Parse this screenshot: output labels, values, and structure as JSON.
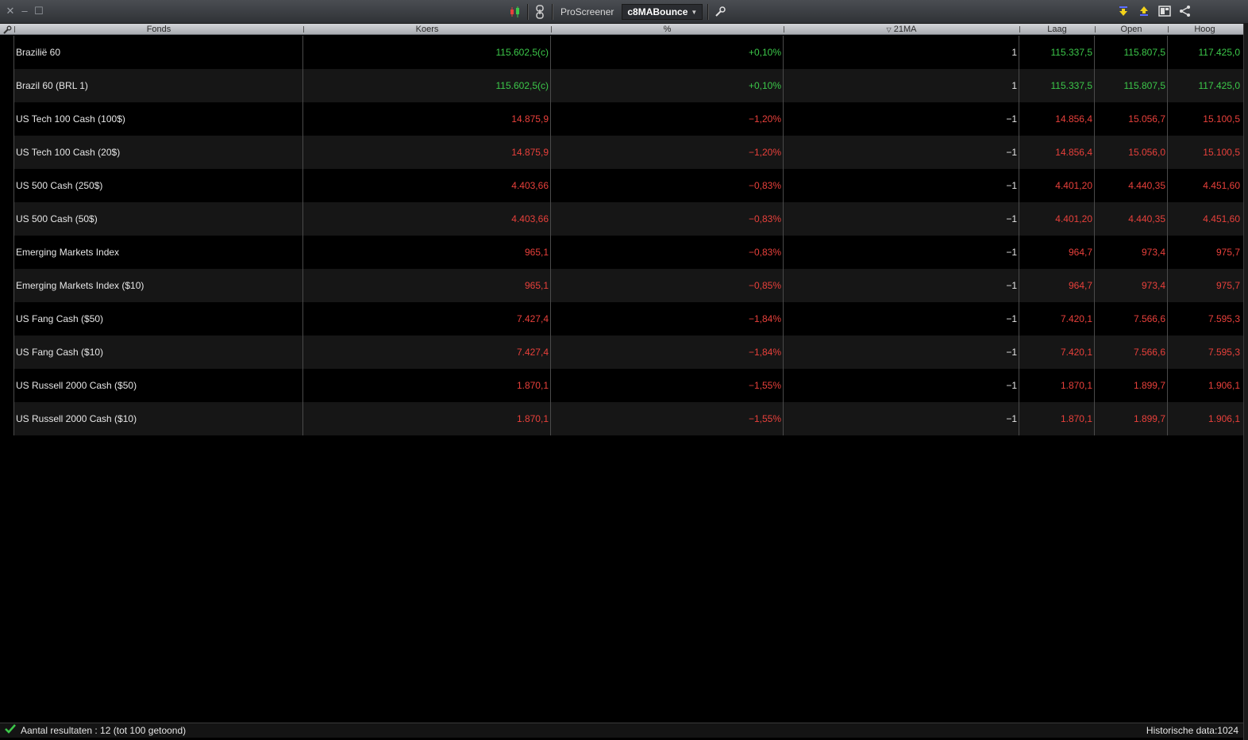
{
  "toolbar": {
    "screener_label": "ProScreener",
    "screener_name": "c8MABounce"
  },
  "columns": {
    "fonds": "Fonds",
    "koers": "Koers",
    "pct": "%",
    "ma": "21MA",
    "laag": "Laag",
    "open": "Open",
    "hoog": "Hoog"
  },
  "rows": [
    {
      "name": "Brazilië 60",
      "koers": "115.602,5(c)",
      "pct": "+0,10%",
      "ma": "1",
      "laag": "115.337,5",
      "open": "115.807,5",
      "hoog": "117.425,0",
      "dir": "up"
    },
    {
      "name": "Brazil 60 (BRL 1)",
      "koers": "115.602,5(c)",
      "pct": "+0,10%",
      "ma": "1",
      "laag": "115.337,5",
      "open": "115.807,5",
      "hoog": "117.425,0",
      "dir": "up"
    },
    {
      "name": "US Tech 100 Cash (100$)",
      "koers": "14.875,9",
      "pct": "−1,20%",
      "ma": "−1",
      "laag": "14.856,4",
      "open": "15.056,7",
      "hoog": "15.100,5",
      "dir": "down"
    },
    {
      "name": "US Tech 100 Cash (20$)",
      "koers": "14.875,9",
      "pct": "−1,20%",
      "ma": "−1",
      "laag": "14.856,4",
      "open": "15.056,0",
      "hoog": "15.100,5",
      "dir": "down"
    },
    {
      "name": "US 500 Cash (250$)",
      "koers": "4.403,66",
      "pct": "−0,83%",
      "ma": "−1",
      "laag": "4.401,20",
      "open": "4.440,35",
      "hoog": "4.451,60",
      "dir": "down"
    },
    {
      "name": "US 500 Cash (50$)",
      "koers": "4.403,66",
      "pct": "−0,83%",
      "ma": "−1",
      "laag": "4.401,20",
      "open": "4.440,35",
      "hoog": "4.451,60",
      "dir": "down"
    },
    {
      "name": "Emerging Markets Index",
      "koers": "965,1",
      "pct": "−0,83%",
      "ma": "−1",
      "laag": "964,7",
      "open": "973,4",
      "hoog": "975,7",
      "dir": "down"
    },
    {
      "name": "Emerging Markets Index ($10)",
      "koers": "965,1",
      "pct": "−0,85%",
      "ma": "−1",
      "laag": "964,7",
      "open": "973,4",
      "hoog": "975,7",
      "dir": "down"
    },
    {
      "name": "US Fang Cash ($50)",
      "koers": "7.427,4",
      "pct": "−1,84%",
      "ma": "−1",
      "laag": "7.420,1",
      "open": "7.566,6",
      "hoog": "7.595,3",
      "dir": "down"
    },
    {
      "name": "US Fang Cash ($10)",
      "koers": "7.427,4",
      "pct": "−1,84%",
      "ma": "−1",
      "laag": "7.420,1",
      "open": "7.566,6",
      "hoog": "7.595,3",
      "dir": "down"
    },
    {
      "name": "US Russell 2000 Cash ($50)",
      "koers": "1.870,1",
      "pct": "−1,55%",
      "ma": "−1",
      "laag": "1.870,1",
      "open": "1.899,7",
      "hoog": "1.906,1",
      "dir": "down"
    },
    {
      "name": "US Russell 2000 Cash ($10)",
      "koers": "1.870,1",
      "pct": "−1,55%",
      "ma": "−1",
      "laag": "1.870,1",
      "open": "1.899,7",
      "hoog": "1.906,1",
      "dir": "down"
    }
  ],
  "status": {
    "results": "Aantal resultaten : 12 (tot 100 getoond)",
    "history": "Historische data:1024"
  },
  "colors": {
    "up": "#3cc84a",
    "down": "#e8403b"
  }
}
